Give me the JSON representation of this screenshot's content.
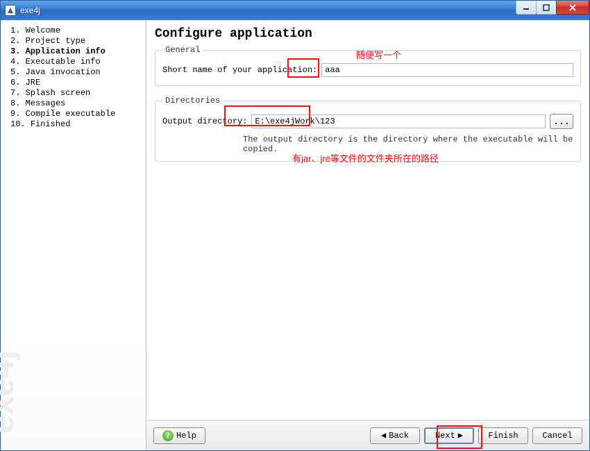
{
  "window": {
    "title": "exe4j"
  },
  "sidebar": {
    "items": [
      {
        "num": "1.",
        "label": "Welcome"
      },
      {
        "num": "2.",
        "label": "Project type"
      },
      {
        "num": "3.",
        "label": "Application info"
      },
      {
        "num": "4.",
        "label": "Executable info"
      },
      {
        "num": "5.",
        "label": "Java invocation"
      },
      {
        "num": "6.",
        "label": "JRE"
      },
      {
        "num": "7.",
        "label": "Splash screen"
      },
      {
        "num": "8.",
        "label": "Messages"
      },
      {
        "num": "9.",
        "label": "Compile executable"
      },
      {
        "num": "10.",
        "label": "Finished"
      }
    ],
    "active_index": 2,
    "watermark": "exe4j"
  },
  "main": {
    "title": "Configure application",
    "general": {
      "legend": "General",
      "short_name_label": "Short name of your application:",
      "short_name_value": "aaa"
    },
    "directories": {
      "legend": "Directories",
      "output_label": "Output directory:",
      "output_value": "E:\\exe4jWork\\123",
      "browse_label": "...",
      "hint": "The output directory is the directory where the executable will be copied."
    }
  },
  "footer": {
    "help_icon": "?",
    "help_label": "Help",
    "back_label": "Back",
    "next_label": "Next",
    "finish_label": "Finish",
    "cancel_label": "Cancel"
  },
  "annotations": {
    "note1": "随便写一个",
    "note2": "有jar、jre等文件的文件夹所在的路径"
  }
}
